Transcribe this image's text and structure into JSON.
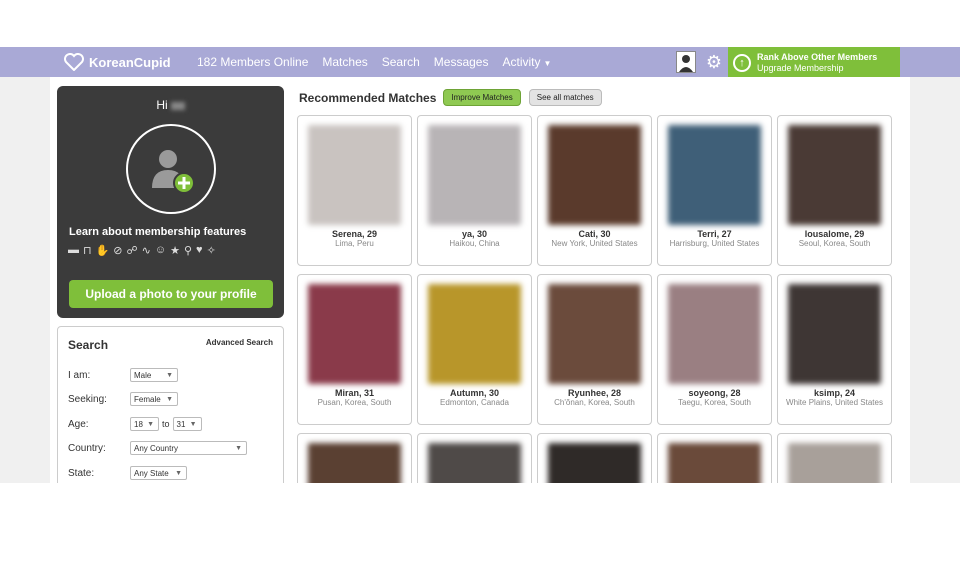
{
  "topbar": {
    "logo_text": "KoreanCupid",
    "nav": [
      "182 Members Online",
      "Matches",
      "Search",
      "Messages",
      "Activity"
    ],
    "upgrade_title": "Rank Above Other Members",
    "upgrade_sub": "Upgrade Membership"
  },
  "profile": {
    "greeting": "Hi",
    "learn_text": "Learn about membership features",
    "upload_label": "Upload a photo to your profile",
    "feature_icons": [
      "chat-icon",
      "unlock-icon",
      "hand-icon",
      "hidden-icon",
      "users-icon",
      "trend-icon",
      "face-icon",
      "star-icon",
      "search-icon",
      "heart-icon",
      "magic-icon"
    ]
  },
  "search": {
    "title": "Search",
    "advanced_label": "Advanced Search",
    "fields": [
      {
        "label": "I am:",
        "value": "Male"
      },
      {
        "label": "Seeking:",
        "value": "Female"
      },
      {
        "label": "Age:",
        "from": "18",
        "to_label": "to",
        "to": "31"
      },
      {
        "label": "Country:",
        "value": "Any Country"
      },
      {
        "label": "State:",
        "value": "Any State"
      }
    ]
  },
  "recommended": {
    "title": "Recommended Matches",
    "improve_label": "Improve Matches",
    "see_all_label": "See all matches"
  },
  "matches": [
    {
      "name": "Serena, 29",
      "loc": "Lima, Peru",
      "color": "#c9c3c0"
    },
    {
      "name": "ya, 30",
      "loc": "Haikou, China",
      "color": "#b8b4b6"
    },
    {
      "name": "Cati, 30",
      "loc": "New York, United States",
      "color": "#5a3a2c"
    },
    {
      "name": "Terri, 27",
      "loc": "Harrisburg, United States",
      "color": "#3f5f78"
    },
    {
      "name": "lousalome, 29",
      "loc": "Seoul, Korea, South",
      "color": "#4a3a35"
    },
    {
      "name": "Miran, 31",
      "loc": "Pusan, Korea, South",
      "color": "#8a3a4a"
    },
    {
      "name": "Autumn, 30",
      "loc": "Edmonton, Canada",
      "color": "#b8962a"
    },
    {
      "name": "Ryunhee, 28",
      "loc": "Ch'ŏnan, Korea, South",
      "color": "#6b4b3c"
    },
    {
      "name": "soyeong, 28",
      "loc": "Taegu, Korea, South",
      "color": "#9a7f82"
    },
    {
      "name": "ksimp, 24",
      "loc": "White Plains, United States",
      "color": "#3e3634"
    },
    {
      "name": "",
      "loc": "",
      "color": "#5a4032"
    },
    {
      "name": "",
      "loc": "",
      "color": "#4f4a48"
    },
    {
      "name": "",
      "loc": "",
      "color": "#2f2a28"
    },
    {
      "name": "",
      "loc": "",
      "color": "#6a4a3a"
    },
    {
      "name": "",
      "loc": "",
      "color": "#a8a09a"
    }
  ]
}
